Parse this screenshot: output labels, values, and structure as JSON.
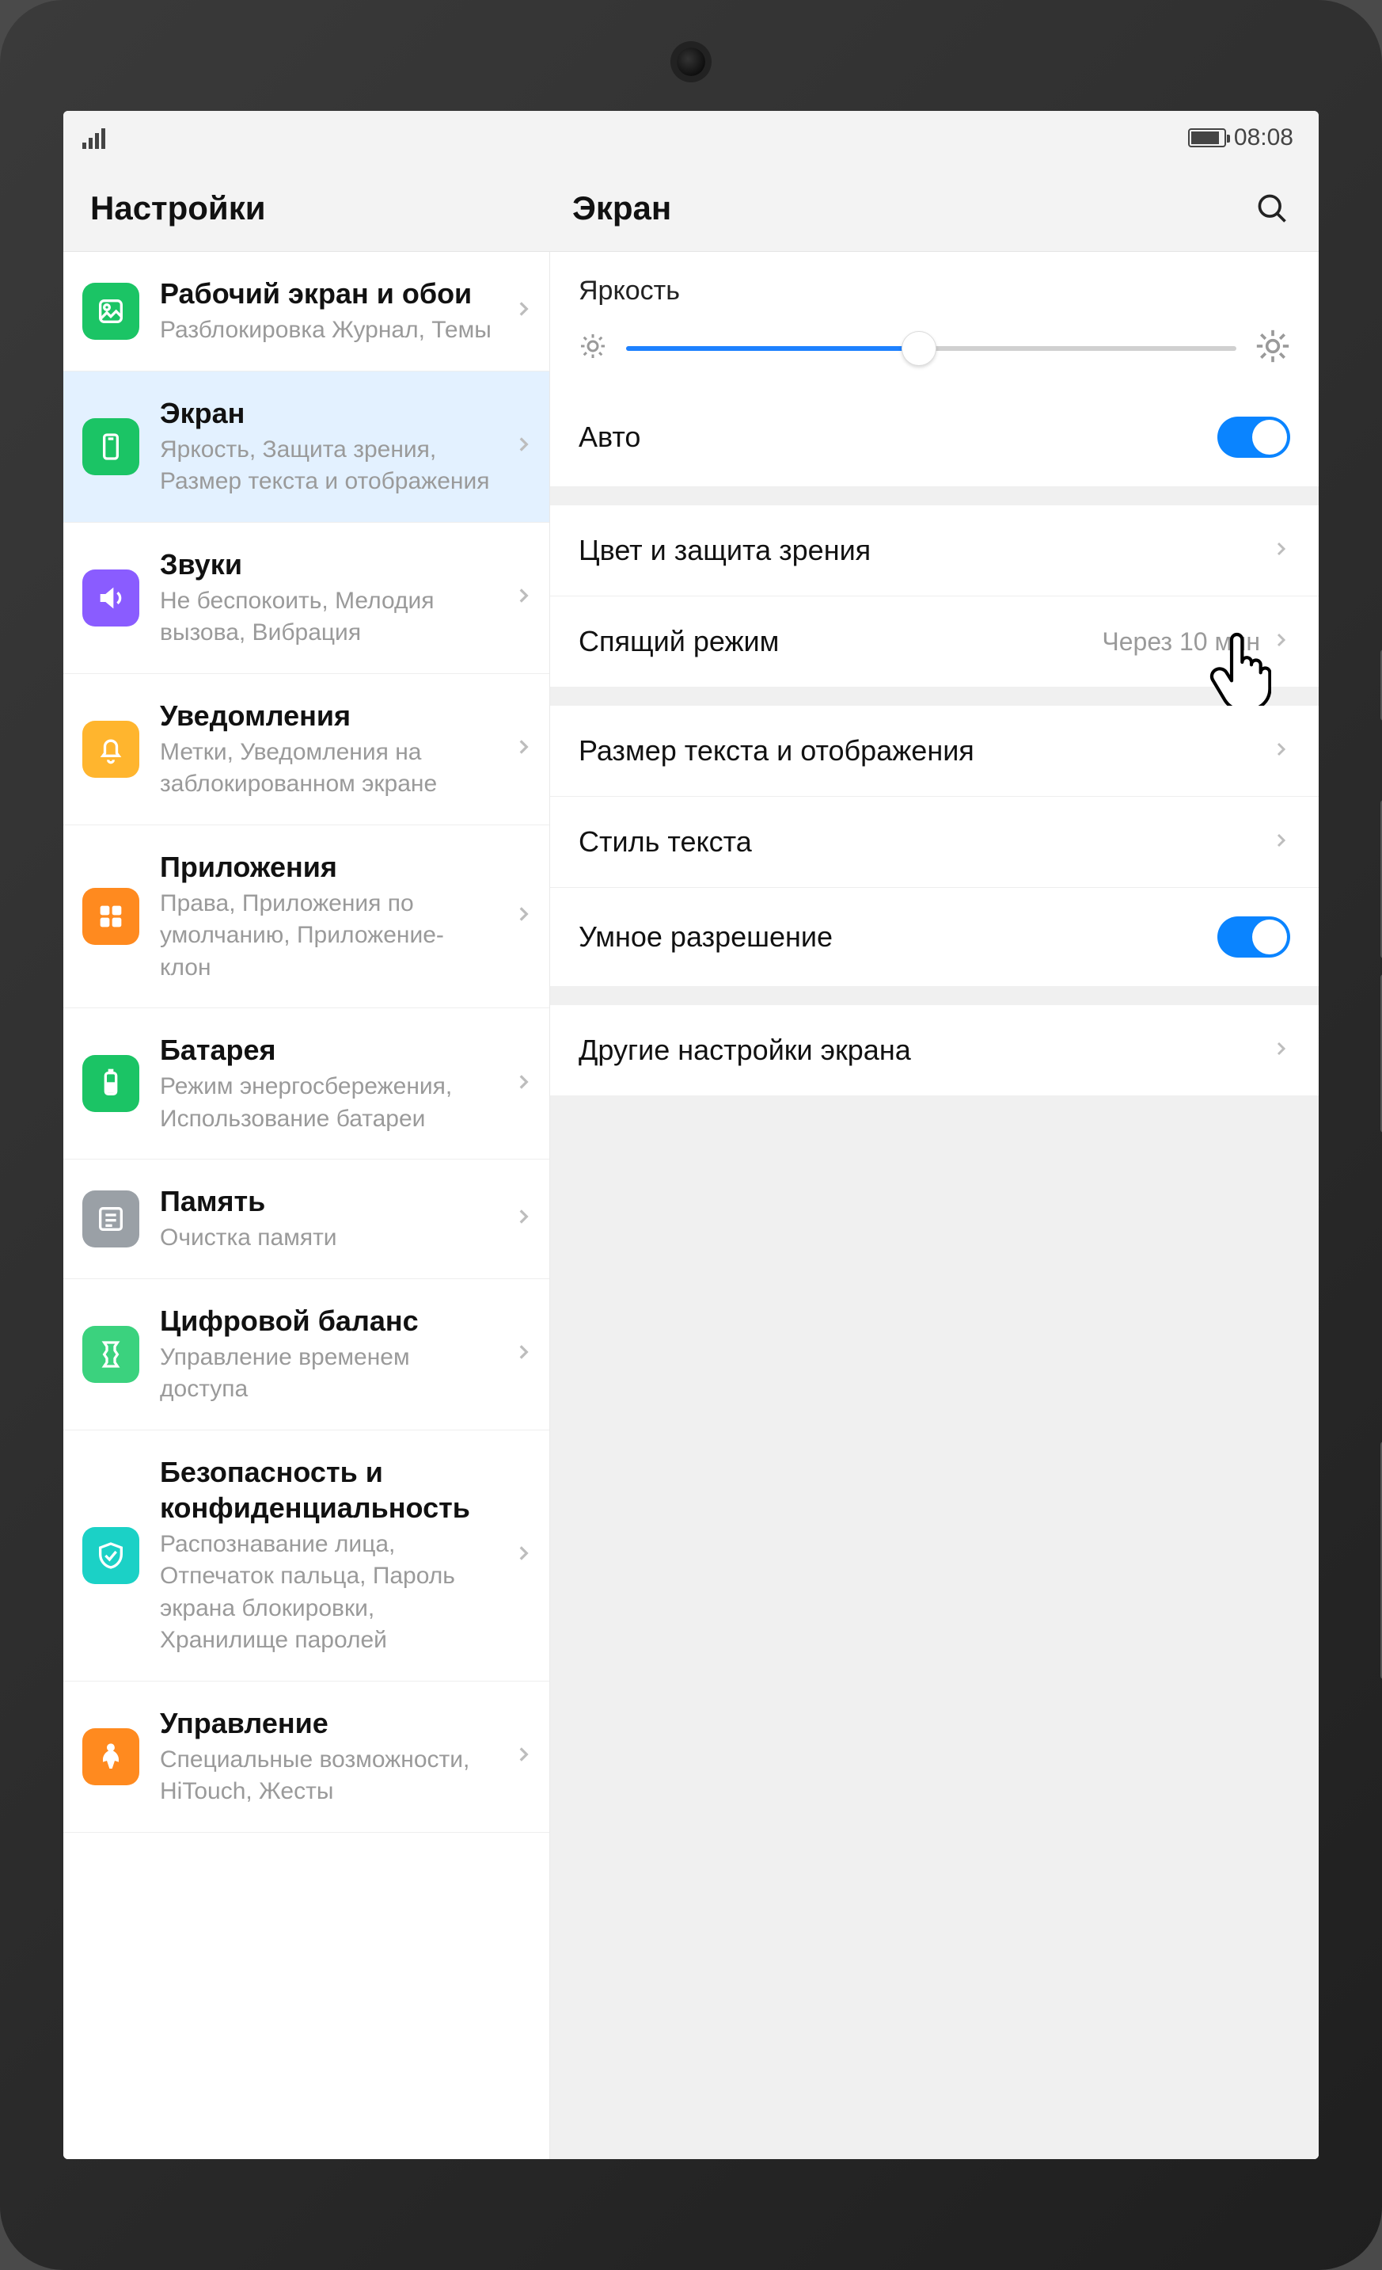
{
  "status": {
    "time": "08:08"
  },
  "header": {
    "sidebar_title": "Настройки",
    "main_title": "Экран"
  },
  "sidebar": {
    "items": [
      {
        "id": "home",
        "title": "Рабочий экран и обои",
        "sub": "Разблокировка Журнал, Темы",
        "color": "ic-green"
      },
      {
        "id": "display",
        "title": "Экран",
        "sub": "Яркость, Защита зрения, Размер текста и отображения",
        "color": "ic-green"
      },
      {
        "id": "sounds",
        "title": "Звуки",
        "sub": "Не беспокоить, Мелодия вызова, Вибрация",
        "color": "ic-purple"
      },
      {
        "id": "notif",
        "title": "Уведомления",
        "sub": "Метки, Уведомления на заблокированном экране",
        "color": "ic-yellow"
      },
      {
        "id": "apps",
        "title": "Приложения",
        "sub": "Права, Приложения по умолчанию, Приложение-клон",
        "color": "ic-orange"
      },
      {
        "id": "battery",
        "title": "Батарея",
        "sub": "Режим энергосбере­жения, Использование батареи",
        "color": "ic-green"
      },
      {
        "id": "memory",
        "title": "Память",
        "sub": "Очистка памяти",
        "color": "ic-grey"
      },
      {
        "id": "balance",
        "title": "Цифровой баланс",
        "sub": "Управление временем доступа",
        "color": "ic-lime"
      },
      {
        "id": "security",
        "title": "Безопасность и конфиденциаль­ность",
        "sub": "Распознавание лица, Отпечаток пальца, Пароль экрана бло­кировки, Хранилище паролей",
        "color": "ic-teal"
      },
      {
        "id": "accessibility",
        "title": "Управление",
        "sub": "Специальные возможности, HiTouch, Жесты",
        "color": "ic-orange"
      }
    ],
    "selected_index": 1
  },
  "main": {
    "brightness_label": "Яркость",
    "brightness_percent": 48,
    "auto_label": "Авто",
    "auto_on": true,
    "sleep_value": "Через 10 мин",
    "smart_res_on": true,
    "rows": {
      "color": "Цвет и защита зрения",
      "sleep": "Спящий режим",
      "textsize": "Размер текста и отображения",
      "textstyle": "Стиль текста",
      "smartres": "Умное разрешение",
      "other": "Другие настройки экрана"
    }
  }
}
